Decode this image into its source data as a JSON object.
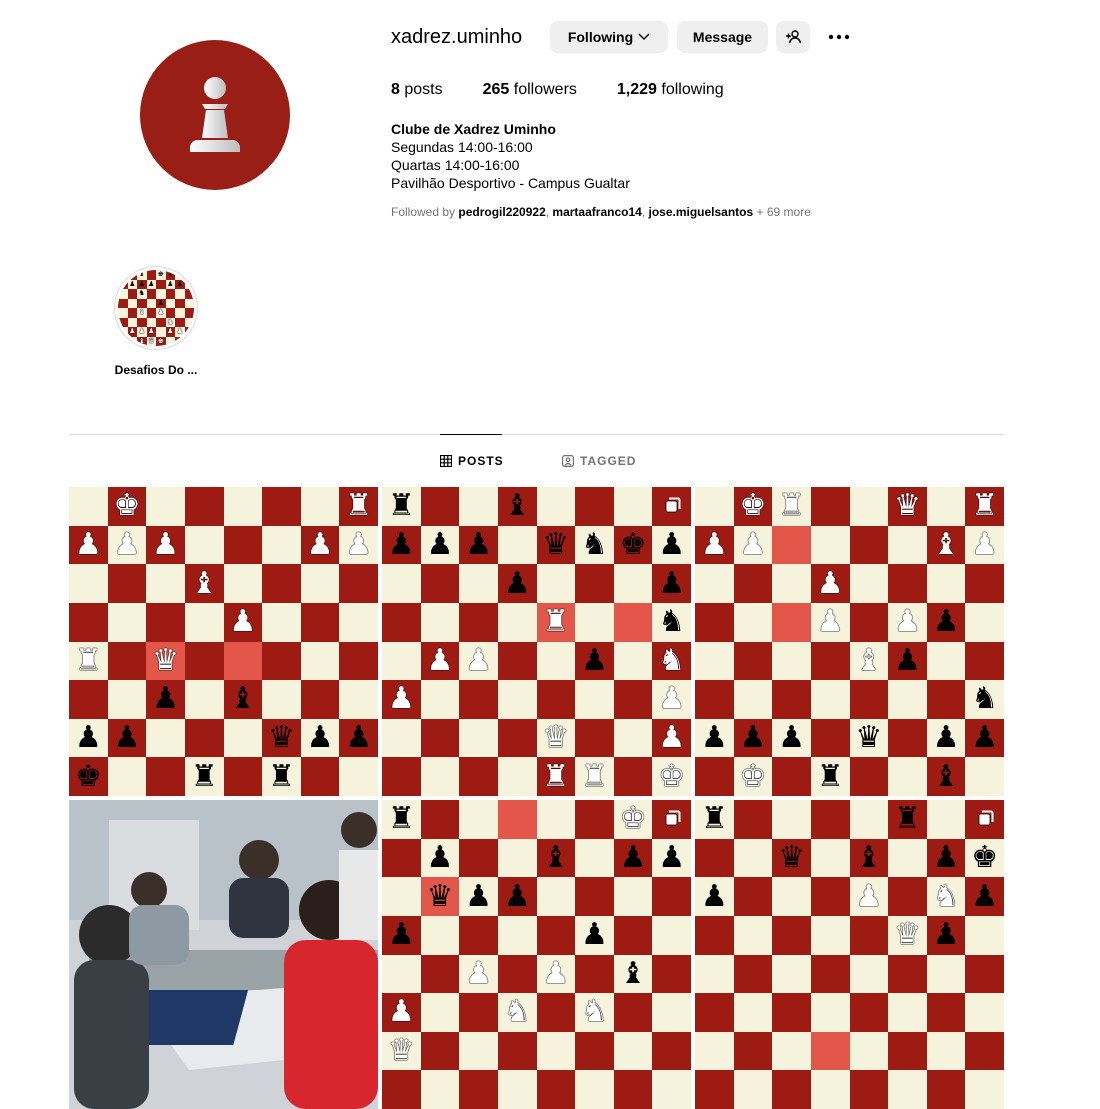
{
  "profile": {
    "username": "xadrez.uminho",
    "following_label": "Following",
    "message_label": "Message",
    "stats": {
      "posts_count": "8",
      "posts_label": "posts",
      "followers_count": "265",
      "followers_label": "followers",
      "following_count": "1,229",
      "following_label": "following"
    },
    "bio": {
      "name": "Clube de Xadrez Uminho",
      "line1": "Segundas 14:00-16:00",
      "line2": "Quartas 14:00-16:00",
      "line3": "Pavilhão Desportivo - Campus Gualtar"
    },
    "followed_by": {
      "prefix": "Followed by",
      "user1": "pedrogil220922",
      "user2": "martaafranco14",
      "user3": "jose.miguelsantos",
      "more": "+ 69 more"
    }
  },
  "highlights": [
    {
      "label": "Desafios Do ..."
    }
  ],
  "tabs": {
    "posts": "POSTS",
    "tagged": "TAGGED"
  },
  "colors": {
    "brand_red": "#981e16",
    "board_light": "#f5f3dc",
    "board_dark": "#9d1b13",
    "highlight_square": "#e2574a",
    "button_bg": "#efefef"
  },
  "posts": [
    {
      "type": "chess-diagram",
      "multi": false,
      "rows": [
        "_K_____R",
        "PPP___PP",
        "___B____",
        "____P___",
        "R_Q_____",
        "__p_b___",
        "pp___qpp",
        "k__r_r__"
      ],
      "highlights": [
        "4,4",
        "4,2"
      ]
    },
    {
      "type": "chess-diagram",
      "multi": true,
      "rows": [
        "r__b____",
        "ppp_qnkp",
        "___p___p",
        "____R__n",
        "_PP__p_N",
        "P______P",
        "____Q__P",
        "____RR_K"
      ],
      "highlights": [
        "3,4",
        "3,6"
      ]
    },
    {
      "type": "chess-diagram",
      "multi": false,
      "rows": [
        "_KR__Q_R",
        "PP____BP",
        "___P____",
        "___P_Pp_",
        "____Bp__",
        "_______n",
        "ppp_q_pp",
        "_K_r__b_"
      ],
      "highlights": [
        "1,2",
        "3,2"
      ]
    },
    {
      "type": "photo",
      "multi": false
    },
    {
      "type": "chess-diagram",
      "multi": true,
      "rows": [
        "r_____K_",
        "_p__b_pp",
        "_qpp____",
        "p____p__",
        "__P_P_b_",
        "P__N_N__",
        "Q_______",
        "________"
      ],
      "highlights": [
        "0,3",
        "2,1"
      ]
    },
    {
      "type": "chess-diagram",
      "multi": true,
      "rows": [
        "r____r__",
        "__q_b_pk",
        "p___P_Np",
        "_____Qp_",
        "________",
        "________",
        "________",
        "________"
      ],
      "highlights": [
        "6,3"
      ]
    }
  ]
}
